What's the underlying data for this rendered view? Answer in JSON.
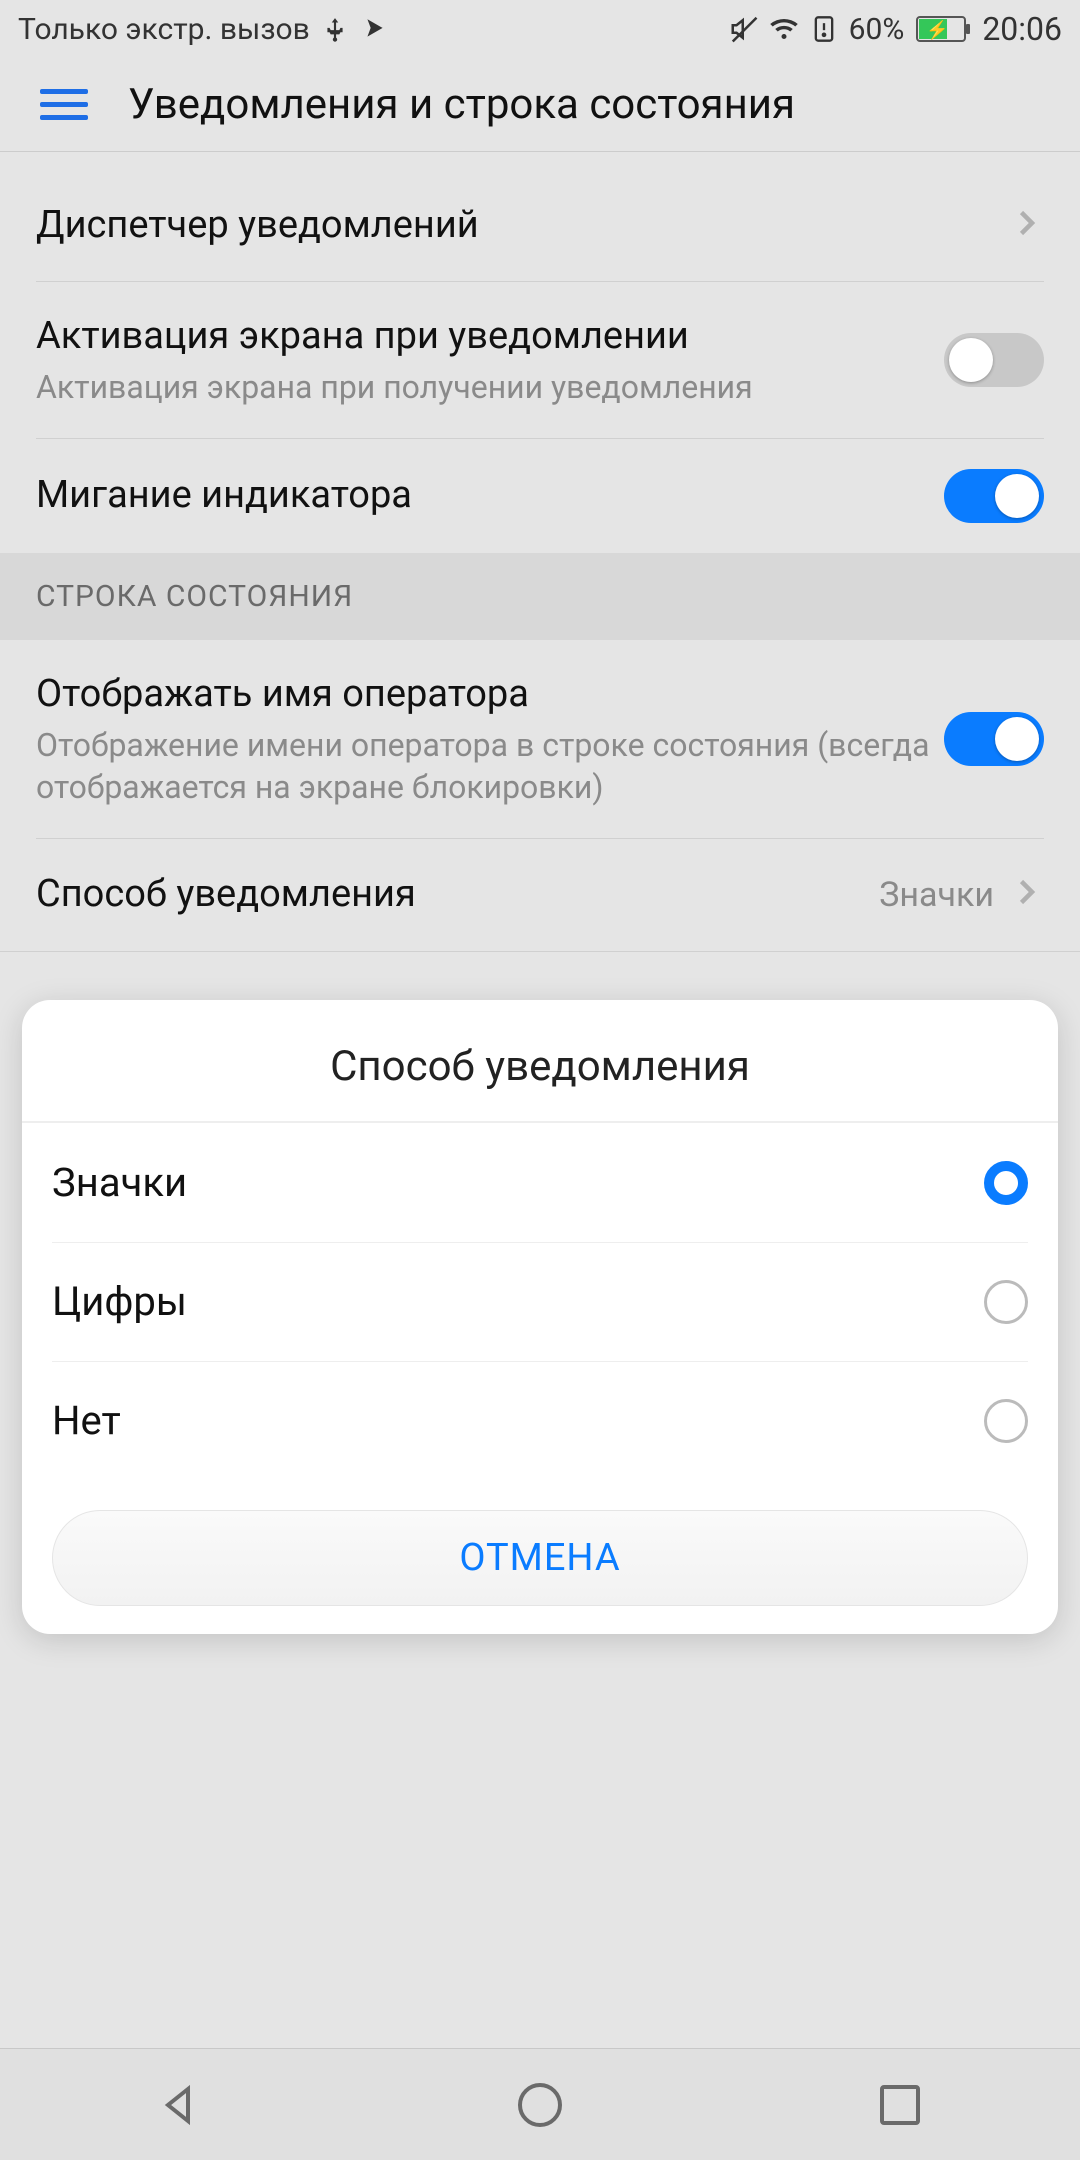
{
  "status": {
    "carrier": "Только экстр. вызов",
    "battery_pct": "60%",
    "time": "20:06"
  },
  "appbar": {
    "title": "Уведомления и строка состояния"
  },
  "rows": {
    "notif_manager": {
      "title": "Диспетчер уведомлений"
    },
    "screen_on": {
      "title": "Активация экрана при уведомлении",
      "sub": "Активация экрана при получении уведомления"
    },
    "led": {
      "title": "Мигание индикатора"
    },
    "section_statusbar": "СТРОКА СОСТОЯНИЯ",
    "carrier_show": {
      "title": "Отображать имя оператора",
      "sub": "Отображение имени оператора в строке состояния (всегда отображается на экране блокировки)"
    },
    "notif_method": {
      "title": "Способ уведомления",
      "value": "Значки"
    }
  },
  "dialog": {
    "title": "Способ уведомления",
    "options": [
      "Значки",
      "Цифры",
      "Нет"
    ],
    "selected_index": 0,
    "cancel": "ОТМЕНА"
  }
}
